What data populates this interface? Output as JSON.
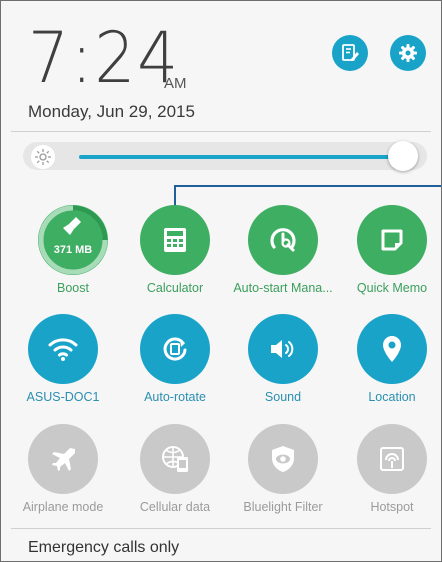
{
  "clock": {
    "time": "7:24",
    "ampm": "AM",
    "date": "Monday, Jun 29, 2015"
  },
  "header_buttons": [
    {
      "name": "edit-settings-button",
      "icon": "edit-icon"
    },
    {
      "name": "settings-button",
      "icon": "gear-icon"
    }
  ],
  "brightness": {
    "level": 0.93,
    "icon": "brightness-icon"
  },
  "tiles": [
    {
      "label": "Boost",
      "icon": "boost-broom-icon",
      "state": "green",
      "value": "371 MB"
    },
    {
      "label": "Calculator",
      "icon": "calculator-icon",
      "state": "green"
    },
    {
      "label": "Auto-start Mana...",
      "icon": "auto-start-icon",
      "state": "green"
    },
    {
      "label": "Quick Memo",
      "icon": "memo-icon",
      "state": "green"
    },
    {
      "label": "ASUS-DOC1",
      "icon": "wifi-icon",
      "state": "on"
    },
    {
      "label": "Auto-rotate",
      "icon": "rotate-icon",
      "state": "on"
    },
    {
      "label": "Sound",
      "icon": "sound-icon",
      "state": "on"
    },
    {
      "label": "Location",
      "icon": "location-icon",
      "state": "on"
    },
    {
      "label": "Airplane mode",
      "icon": "airplane-icon",
      "state": "off"
    },
    {
      "label": "Cellular data",
      "icon": "cellular-data-icon",
      "state": "off"
    },
    {
      "label": "Bluelight Filter",
      "icon": "bluelight-filter-icon",
      "state": "off"
    },
    {
      "label": "Hotspot",
      "icon": "hotspot-icon",
      "state": "off"
    }
  ],
  "footer": {
    "status": "Emergency calls only"
  },
  "colors": {
    "accent": "#1aa3c8",
    "green": "#3dae62",
    "disabled": "#c9c9c9",
    "callout": "#1f5f9a"
  }
}
